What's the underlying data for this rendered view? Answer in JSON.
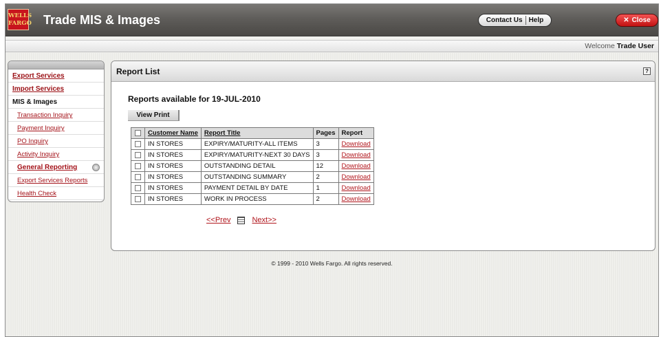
{
  "app": {
    "logo_text": "WELLS FARGO",
    "title": "Trade MIS & Images"
  },
  "topnav": {
    "contact_label": "Contact Us",
    "help_label": "Help",
    "close_label": "Close",
    "close_symbol": "✕"
  },
  "welcome": {
    "prefix": "Welcome",
    "user": "Trade User"
  },
  "sidebar": {
    "items": [
      {
        "label": "Export Services"
      },
      {
        "label": "Import Services"
      },
      {
        "label": "MIS & Images"
      },
      {
        "label": "Transaction Inquiry"
      },
      {
        "label": "Payment Inquiry"
      },
      {
        "label": "PO Inquiry"
      },
      {
        "label": "Activity Inquiry"
      },
      {
        "label": "General Reporting"
      },
      {
        "label": "Export Services Reports"
      },
      {
        "label": "Health Check"
      }
    ]
  },
  "panel": {
    "title": "Report List",
    "help_symbol": "?",
    "reports_heading": "Reports available for 19-JUL-2010",
    "view_print_label": "View Print",
    "columns": [
      "Customer Name",
      "Report Title",
      "Pages",
      "Report"
    ],
    "rows": [
      {
        "customer": "IN STORES",
        "title": "EXPIRY/MATURITY-ALL ITEMS",
        "pages": "3",
        "link": "Download"
      },
      {
        "customer": "IN STORES",
        "title": "EXPIRY/MATURITY-NEXT 30 DAYS",
        "pages": "3",
        "link": "Download"
      },
      {
        "customer": "IN STORES",
        "title": "OUTSTANDING DETAIL",
        "pages": "12",
        "link": "Download"
      },
      {
        "customer": "IN STORES",
        "title": "OUTSTANDING SUMMARY",
        "pages": "2",
        "link": "Download"
      },
      {
        "customer": "IN STORES",
        "title": "PAYMENT DETAIL BY DATE",
        "pages": "1",
        "link": "Download"
      },
      {
        "customer": "IN STORES",
        "title": "WORK IN PROCESS",
        "pages": "2",
        "link": "Download"
      }
    ],
    "pager": {
      "prev_label": "<<Prev",
      "next_label": "Next>>"
    }
  },
  "footer": {
    "text": "© 1999 - 2010 Wells Fargo. All rights reserved."
  },
  "colors": {
    "brand_red": "#c8141e",
    "link_red": "#b0141b",
    "header_gray": "#5f5d5a"
  },
  "icons": {
    "help": "help-icon",
    "calendar": "calendar-icon",
    "close": "close-icon",
    "expand": "expand-plus-icon"
  }
}
